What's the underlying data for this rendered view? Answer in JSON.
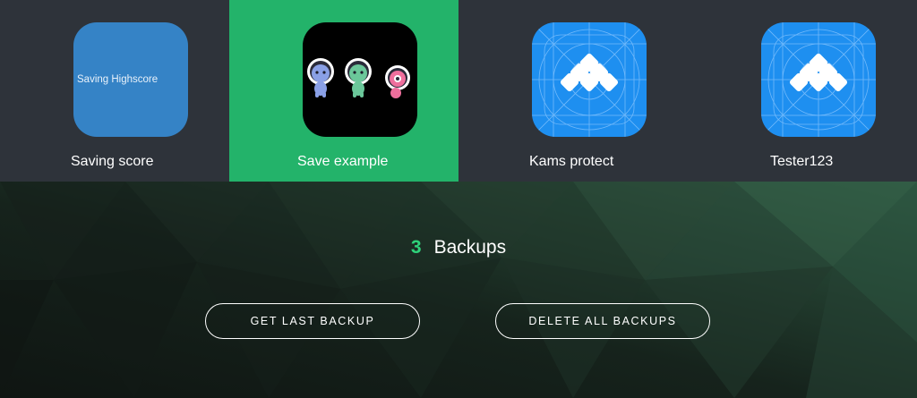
{
  "apps": [
    {
      "name": "Saving score",
      "icon": "text-icon",
      "icon_text": "Saving Highscore",
      "icon_color": "#3583c6"
    },
    {
      "name": "Save example",
      "icon": "astronauts-icon",
      "selected": true
    },
    {
      "name": "Kams protect",
      "icon": "app-grid-icon",
      "icon_color": "#1e8ff0"
    },
    {
      "name": "Tester123",
      "icon": "app-grid-icon",
      "icon_color": "#1e8ff0"
    }
  ],
  "backups": {
    "count": "3",
    "label": "Backups"
  },
  "actions": {
    "get_last": "GET LAST BACKUP",
    "delete_all": "DELETE ALL BACKUPS"
  },
  "colors": {
    "strip_bg": "#2e333a",
    "selected_bg": "#23b36a",
    "accent_green": "#2fd27a"
  }
}
